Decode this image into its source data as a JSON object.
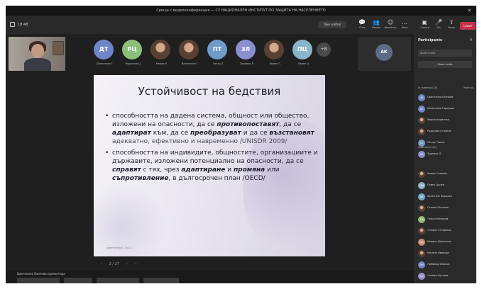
{
  "window": {
    "title": "Среща с видеоконференция — СУ НАЦИОНАЛЕН ИНСТИТУТ ПО ЗАЩИТА НА НАСЕЛЕНИЕТО",
    "close_glyph": "✕"
  },
  "toolbar": {
    "timer": "18:48",
    "take_control_label": "Take control",
    "buttons": [
      {
        "icon": "chat-icon",
        "glyph": "💬",
        "label": "Chat"
      },
      {
        "icon": "people-icon",
        "glyph": "👥",
        "label": "People"
      },
      {
        "icon": "reactions-icon",
        "glyph": "☺",
        "label": "Reactions"
      },
      {
        "icon": "more-icon",
        "glyph": "…",
        "label": "More"
      },
      {
        "icon": "camera-icon",
        "glyph": "▣",
        "label": "Camera"
      },
      {
        "icon": "mic-icon",
        "glyph": "🎤",
        "label": "Mic"
      },
      {
        "icon": "share-icon",
        "glyph": "⇪",
        "label": "Share"
      }
    ],
    "leave_label": "Leave"
  },
  "participants_strip": [
    {
      "initials": "ДТ",
      "color": "#6f85c9",
      "name": "Десислава Т."
    },
    {
      "initials": "РЦ",
      "color": "#8bbf7a",
      "name": "Радослав Ц."
    },
    {
      "initials": "",
      "color": "#8a7a6a",
      "name": "Мария К."
    },
    {
      "initials": "",
      "color": "#9a8070",
      "name": "Валентина Г."
    },
    {
      "initials": "ПТ",
      "color": "#6f9bc9",
      "name": "Петър Т."
    },
    {
      "initials": "ЗЛ",
      "color": "#8a8fd1",
      "name": "Здравко Л."
    },
    {
      "initials": "",
      "color": "#7a6a5a",
      "name": "Ирина С."
    },
    {
      "initials": "ПЦ",
      "color": "#8ab4c9",
      "name": "Павел Ц."
    }
  ],
  "more_count": "+8",
  "pinned": {
    "initials": "АК"
  },
  "slide": {
    "title": "Устойчивост на бедствия",
    "bullet1": {
      "t1": "способността на дадена система, общност или общество, изложени на опасности, да се ",
      "e1": "противопоставят",
      "t2": ", да се ",
      "e2": "адаптират",
      "t3": " към, да се ",
      "e3": "преобразуват",
      "t4": " и да се ",
      "e4": "възстановят",
      "t5": " адекватно, ефективно и навременно /UNISDR 2009/"
    },
    "bullet2": {
      "t1": "способността на индивидите, общностите, организациите и държавите, изложени потенциално на опасности, да се ",
      "e1": "справят",
      "t2": " с тях, чрез ",
      "e2": "адаптиране",
      "t3": " и ",
      "e3": "промяна",
      "t4": " или ",
      "e4": "съпротивление",
      "t5": ", в дългосрочен план /OECD/"
    },
    "footer": "Цветелина Б. 2021"
  },
  "slide_controls": {
    "prev": "‹",
    "page": "2 / 27",
    "next": "›",
    "menu": "⋯"
  },
  "presenter": "Цветелина Банчева презентира",
  "panel": {
    "header": "Participants",
    "close": "✕",
    "share_box": "Share invite",
    "share_button": "Share invite",
    "in_meeting": "In meeting (25)",
    "mute_all": "Mute all",
    "presenters": "Presenters (1)",
    "attendees": "Attendees (24)",
    "people": [
      {
        "initials": "ЦБ",
        "color": "#6f85c9",
        "name": "Цветелина Банчева"
      },
      {
        "initials": "ДТ",
        "color": "#6f85c9",
        "name": "Десислава Тодорова"
      },
      {
        "initials": "",
        "color": "#7a6a5a",
        "name": "Мария Кирилова"
      },
      {
        "initials": "",
        "color": "#9a8070",
        "name": "Радослав Стоянов"
      },
      {
        "initials": "ПТ",
        "color": "#6f9bc9",
        "name": "Петър Томов"
      },
      {
        "initials": "ЗЛ",
        "color": "#8a8fd1",
        "name": "Здравко Л."
      },
      {
        "initials": "",
        "color": "#7a6a5a",
        "name": "Ирина Славова"
      },
      {
        "initials": "ПЦ",
        "color": "#8ab4c9",
        "name": "Павел Цонев"
      },
      {
        "initials": "ВК",
        "color": "#6fa9c9",
        "name": "Валентин Кирилов"
      },
      {
        "initials": "",
        "color": "#7d6b5c",
        "name": "Галина Петкова"
      },
      {
        "initials": "ГН",
        "color": "#8fbf7a",
        "name": "Георги Николов"
      },
      {
        "initials": "",
        "color": "#6a5e55",
        "name": "Стефан Стефанов"
      },
      {
        "initials": "ЙД",
        "color": "#c98a6f",
        "name": "Йордан Димитров"
      },
      {
        "initials": "",
        "color": "#7a6a5a",
        "name": "Милена Иванова"
      },
      {
        "initials": "ЛИ",
        "color": "#6f85c9",
        "name": "Любомир Иванов"
      },
      {
        "initials": "СК",
        "color": "#9a8fd1",
        "name": "Силвия Костова"
      }
    ]
  }
}
